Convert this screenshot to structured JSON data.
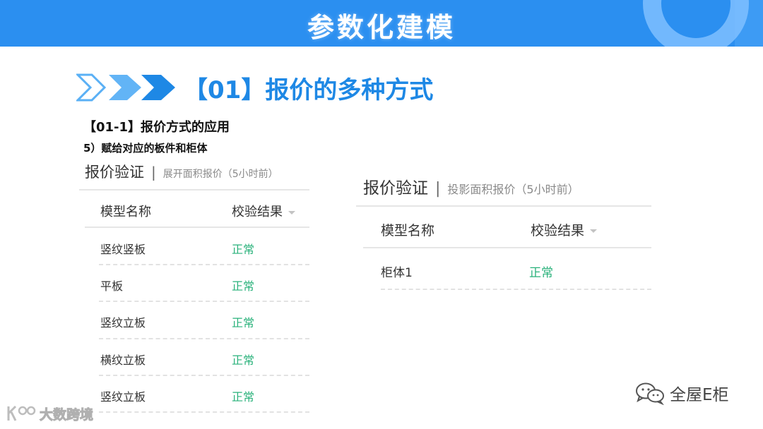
{
  "banner": {
    "title": "参数化建模"
  },
  "section": {
    "title": "【01】报价的多种方式"
  },
  "subtitle": "【01-1】报价方式的应用",
  "step": "5）赋给对应的板件和柜体",
  "left_panel": {
    "title": "报价验证",
    "separator": "|",
    "subtitle": "展开面积报价（5小时前）",
    "columns": [
      "模型名称",
      "校验结果"
    ],
    "rows": [
      {
        "name": "竖纹竖板",
        "status": "正常"
      },
      {
        "name": "平板",
        "status": "正常"
      },
      {
        "name": "竖纹立板",
        "status": "正常"
      },
      {
        "name": "横纹立板",
        "status": "正常"
      },
      {
        "name": "竖纹立板",
        "status": "正常"
      }
    ]
  },
  "right_panel": {
    "title": "报价验证",
    "separator": "|",
    "subtitle": "投影面积报价（5小时前）",
    "columns": [
      "模型名称",
      "校验结果"
    ],
    "rows": [
      {
        "name": "柜体1",
        "status": "正常"
      }
    ]
  },
  "watermarks": {
    "right": "全屋E柜",
    "left": "大数跨境",
    "right_icon": "wechat-icon",
    "left_icon": "brand-logo-icon"
  },
  "colors": {
    "banner": "#2b8ff0",
    "accent": "#1e88e5",
    "status_ok": "#2ab27b"
  }
}
